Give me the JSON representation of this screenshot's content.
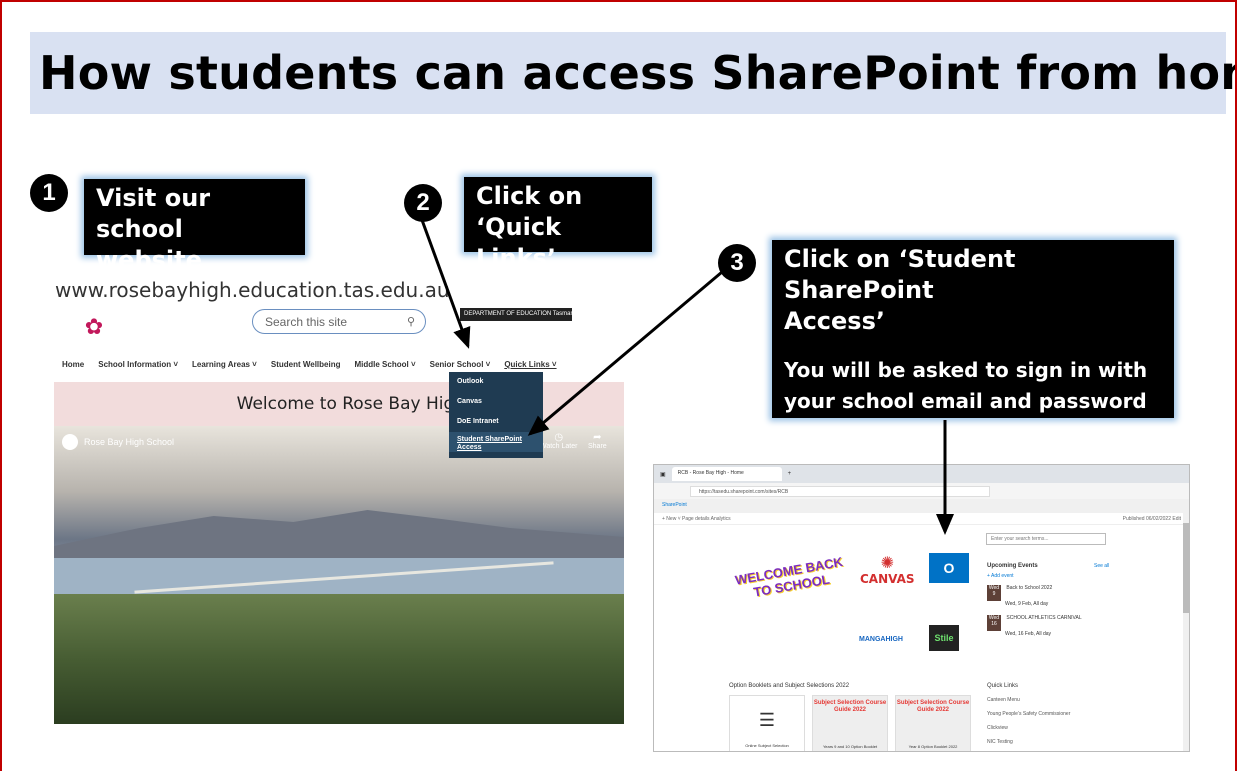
{
  "title": "How students can access SharePoint from home ...",
  "steps": [
    {
      "number": "1",
      "text_lines": [
        "Visit our school",
        "website"
      ]
    },
    {
      "number": "2",
      "text_lines": [
        "Click on",
        "‘Quick Links’"
      ]
    },
    {
      "number": "3",
      "text_lines": [
        "Click on ‘Student SharePoint",
        "Access’",
        "",
        "You will be asked to sign in with",
        "your school email and password"
      ]
    }
  ],
  "website": {
    "url": "www.rosebayhigh.education.tas.edu.au",
    "search_placeholder": "Search this site",
    "doe_banner": "DEPARTMENT OF EDUCATION Tasmania",
    "nav": [
      "Home",
      "School Information ˅",
      "Learning Areas ˅",
      "Student Wellbeing",
      "Middle School ˅",
      "Senior School ˅",
      "Quick Links ˅"
    ],
    "welcome": "Welcome to Rose Bay High Sch",
    "video_title": "Rose Bay High School",
    "watch_later": "Watch Later",
    "share": "Share",
    "dropdown": [
      "Outlook",
      "Canvas",
      "DoE Intranet",
      "Student SharePoint Access"
    ]
  },
  "sharepoint": {
    "tab_title": "RCB - Rose Bay High - Home",
    "address": "https://tasedu.sharepoint.com/sites/RCB",
    "suite": "SharePoint",
    "commands": "+ New ˅   Page details   Analytics",
    "published": "Published 06/02/2022   Edit",
    "search": "Enter your search terms...",
    "welcome_art": "WELCOME BACK TO SCHOOL",
    "canvas": "CANVAS",
    "outlook": "O",
    "mangahigh": "MANGAHIGH",
    "stile": "Stile",
    "events_title": "Upcoming Events",
    "see_all": "See all",
    "add_event": "+ Add event",
    "events": [
      {
        "day": "Wed 9",
        "name": "Back to School 2022",
        "when": "Wed, 9 Feb, All day"
      },
      {
        "day": "Wed 16",
        "name": "SCHOOL ATHLETICS CARNIVAL",
        "when": "Wed, 16 Feb, All day"
      }
    ],
    "section_title": "Option Booklets and Subject Selections 2022",
    "quick_links_title": "Quick Links",
    "cards": [
      "",
      "Subject Selection Course Guide 2022",
      "Subject Selection Course Guide 2022"
    ],
    "card_captions": [
      "Online Subject Selection",
      "Years 9 and 10 Option Booklet",
      "Year 8 Option Booklet 2022"
    ],
    "quick_links": [
      "Canteen Menu",
      "Young People’s Safety Commissioner",
      "Clickview",
      "NIC Testing"
    ]
  },
  "colors": {
    "border": "#c00000",
    "title_bg": "#d9e1f2",
    "callout_bg": "#000000",
    "callout_glow": "#9cc3e6"
  }
}
